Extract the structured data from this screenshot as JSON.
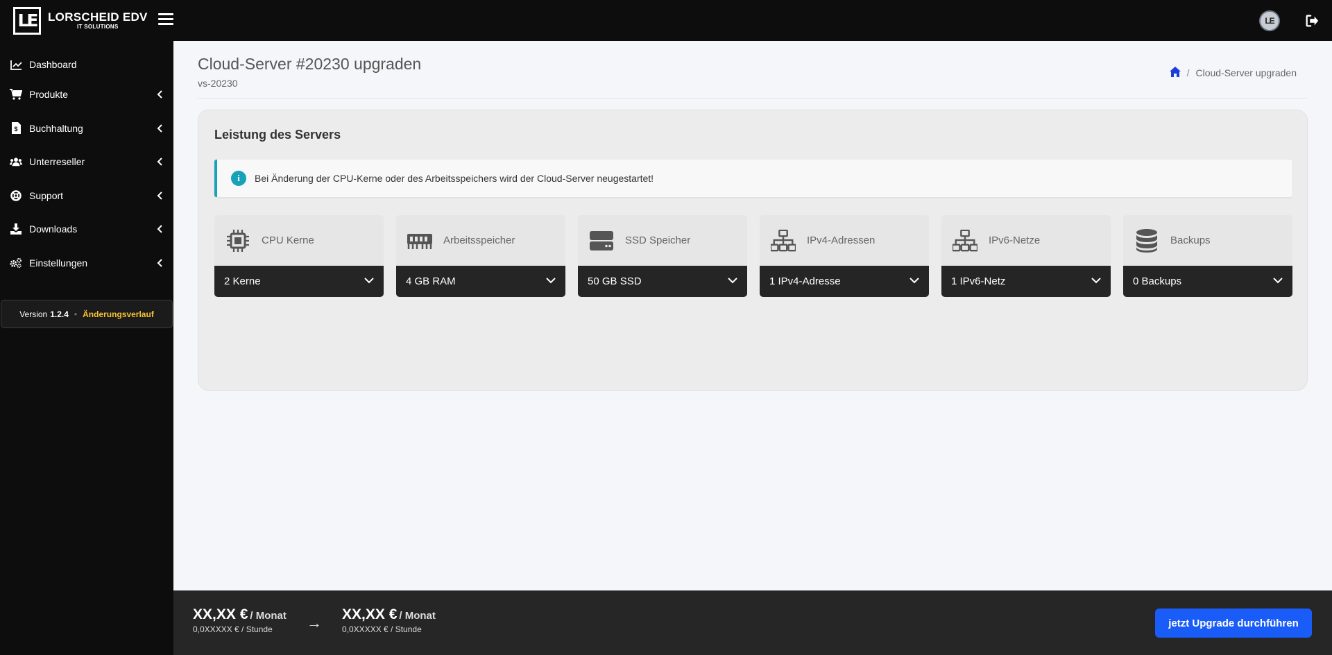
{
  "brand": {
    "logo_text": "LE",
    "title": "LORSCHEID EDV",
    "subtitle": "IT SOLUTIONS"
  },
  "topbar": {
    "avatar_text": "LE"
  },
  "sidebar": {
    "items": [
      {
        "label": "Dashboard",
        "icon": "chart-line-icon",
        "has_submenu": false
      },
      {
        "label": "Produkte",
        "icon": "shopping-cart-icon",
        "has_submenu": true
      },
      {
        "label": "Buchhaltung",
        "icon": "invoice-icon",
        "has_submenu": true
      },
      {
        "label": "Unterreseller",
        "icon": "users-icon",
        "has_submenu": true
      },
      {
        "label": "Support",
        "icon": "life-ring-icon",
        "has_submenu": true
      },
      {
        "label": "Downloads",
        "icon": "download-icon",
        "has_submenu": true
      },
      {
        "label": "Einstellungen",
        "icon": "cogs-icon",
        "has_submenu": true
      }
    ],
    "version": {
      "prefix": "Version",
      "number": "1.2.4",
      "link_label": "Änderungsverlauf",
      "link_color": "#f7c32e"
    }
  },
  "header": {
    "title": "Cloud-Server #20230 upgraden",
    "subtitle": "vs-20230",
    "breadcrumb": {
      "home_icon": "home-icon",
      "current": "Cloud-Server upgraden"
    }
  },
  "card": {
    "title": "Leistung des Servers",
    "alert": "Bei Änderung der CPU-Kerne oder des Arbeitsspeichers wird der Cloud-Server neugestartet!",
    "options": [
      {
        "label": "CPU Kerne",
        "icon": "microchip-icon",
        "value": "2 Kerne"
      },
      {
        "label": "Arbeitsspeicher",
        "icon": "memory-icon",
        "value": "4 GB RAM"
      },
      {
        "label": "SSD Speicher",
        "icon": "hdd-icon",
        "value": "50 GB SSD"
      },
      {
        "label": "IPv4-Adressen",
        "icon": "network-icon",
        "value": "1 IPv4-Adresse"
      },
      {
        "label": "IPv6-Netze",
        "icon": "network-icon",
        "value": "1 IPv6-Netz"
      },
      {
        "label": "Backups",
        "icon": "database-icon",
        "value": "0 Backups"
      }
    ]
  },
  "footer": {
    "current": {
      "price": "XX,XX €",
      "per": "/ Monat",
      "hourly": "0,0XXXXX € / Stunde"
    },
    "arrow": "→",
    "new": {
      "price": "XX,XX €",
      "per": "/ Monat",
      "hourly": "0,0XXXXX € / Stunde"
    },
    "button_label": "jetzt Upgrade durchführen",
    "button_color": "#1a5cf8"
  },
  "colors": {
    "accent_info": "#17a2b8",
    "sidebar_bg": "#0d0d0d",
    "select_bg": "#252525"
  }
}
